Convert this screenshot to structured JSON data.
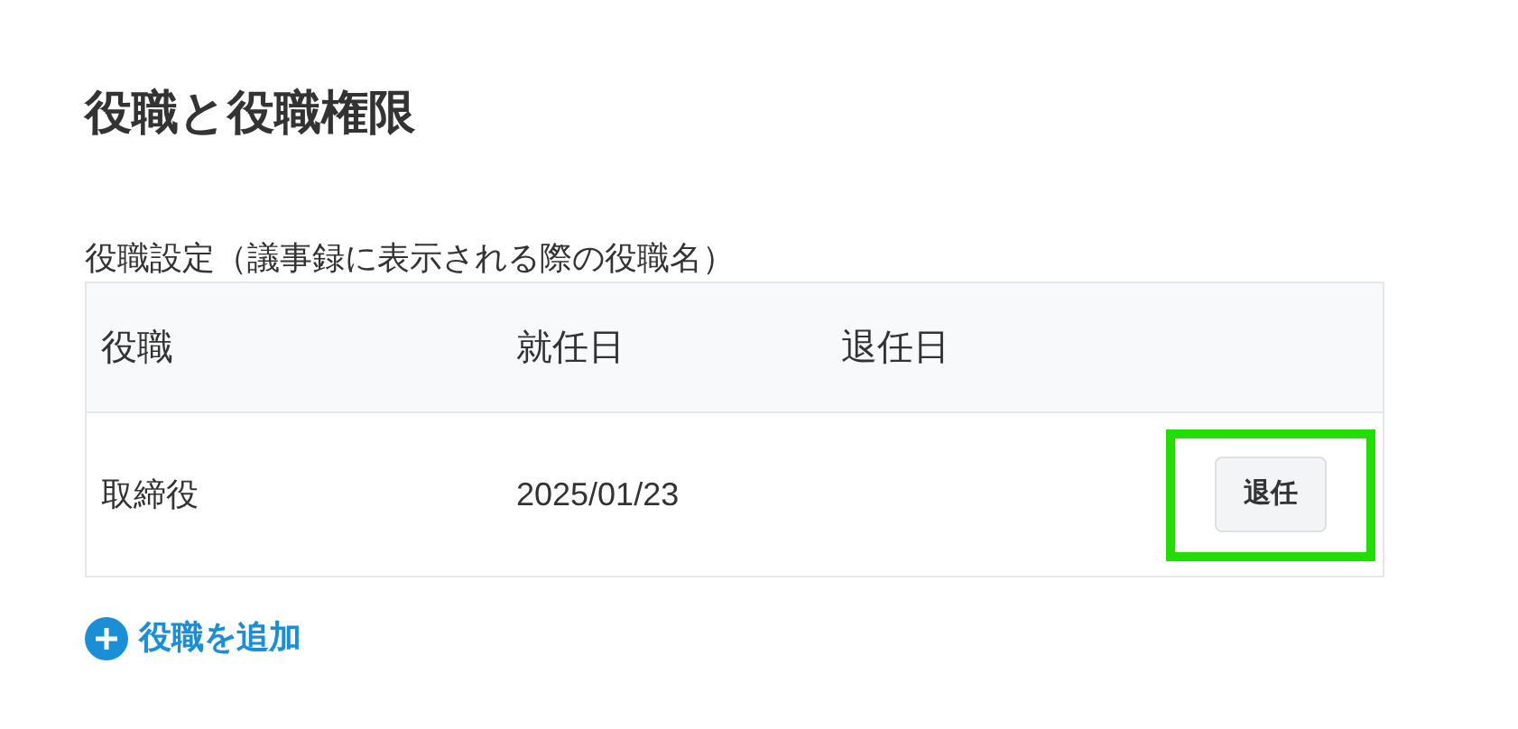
{
  "title": "役職と役職権限",
  "section_label": "役職設定（議事録に表示される際の役職名）",
  "table": {
    "columns": [
      "役職",
      "就任日",
      "退任日"
    ],
    "rows": [
      {
        "cells": [
          "取締役",
          "2025/01/23",
          ""
        ],
        "action": "退任",
        "highlighted": true
      }
    ]
  },
  "add_link": "役職を追加"
}
